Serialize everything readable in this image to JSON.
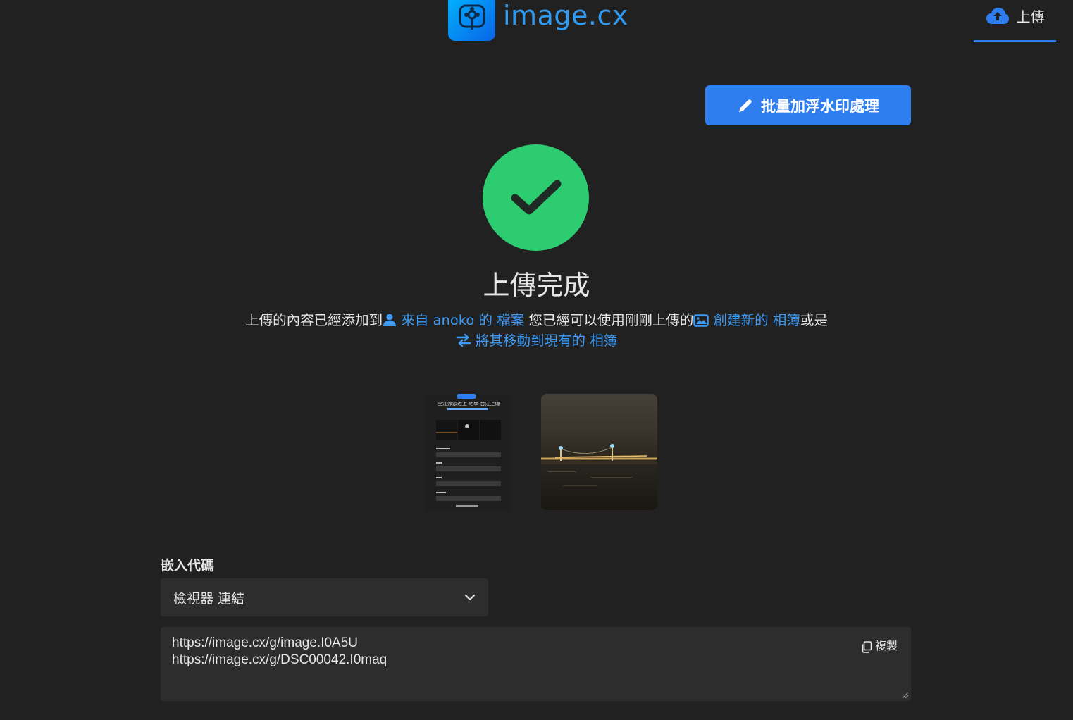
{
  "header": {
    "logo_text": "image.cx",
    "nav_upload_label": "上傳"
  },
  "actions": {
    "watermark_button": "批量加浮水印處理"
  },
  "success": {
    "title": "上傳完成",
    "msg_prefix": "上傳的內容已經添加到",
    "link_profile": "來自 anoko 的 檔案",
    "msg_middle": " 您已經可以使用剛剛上傳的",
    "link_create_album": "創建新的 相簿",
    "msg_or": "或是",
    "link_move_album": "將其移動到現有的 相簿"
  },
  "thumb_screenshot": {
    "title_line": "全江郊頭近上 旭學 台江上傳"
  },
  "embed": {
    "label": "嵌入代碼",
    "selected_option": "檢視器 連結",
    "code_lines": [
      "https://image.cx/g/image.I0A5U",
      "https://image.cx/g/DSC00042.I0maq"
    ],
    "copy_label": "複製"
  },
  "colors": {
    "background": "#212121",
    "accent": "#2f7ef0",
    "link": "#3d9bf5",
    "success": "#2ecc71",
    "panel": "#2d2d2d"
  },
  "icons": {
    "nav_upload": "cloud-upload-icon",
    "watermark": "pencil-icon",
    "success": "check-icon",
    "profile": "user-icon",
    "album": "image-icon",
    "move": "arrows-exchange-icon",
    "select": "chevron-down-icon",
    "copy": "copy-icon"
  }
}
